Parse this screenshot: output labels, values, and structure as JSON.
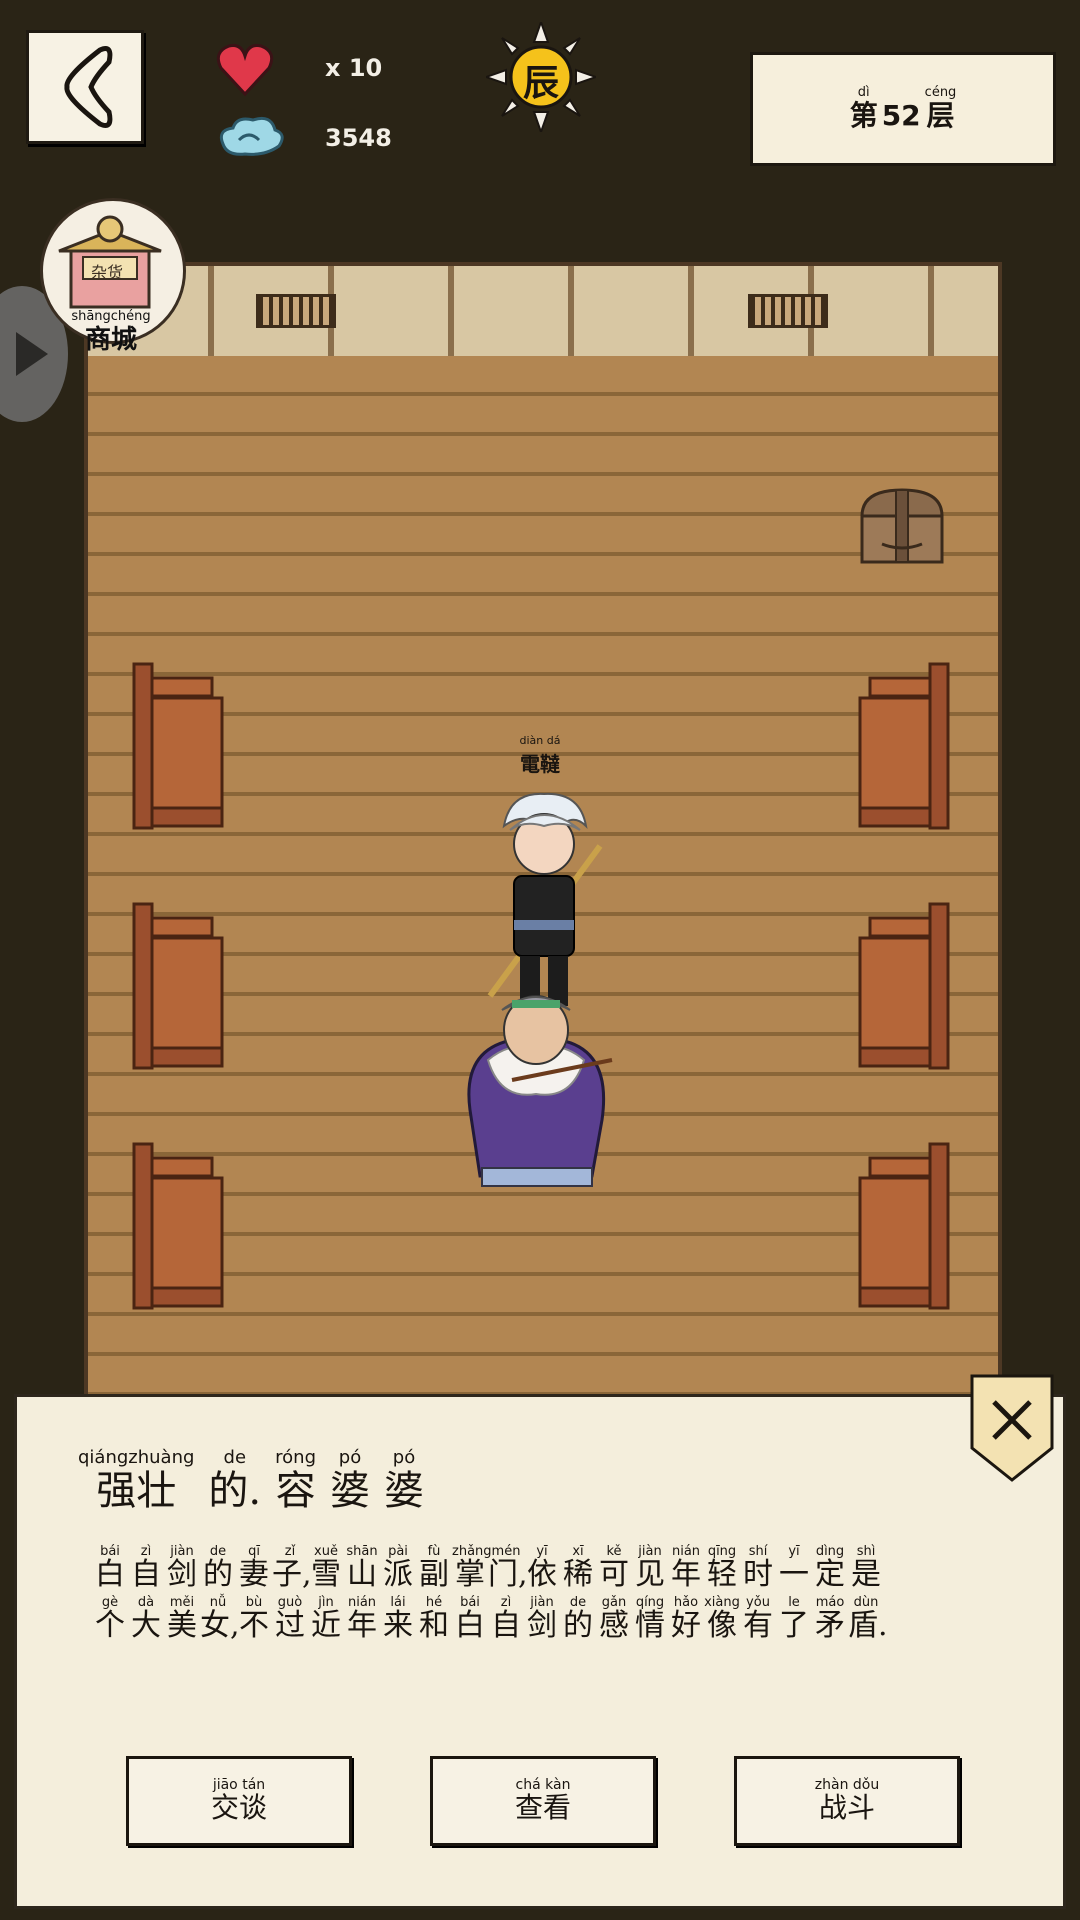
{
  "colors": {
    "background": "#2a2416",
    "panel": "#f4eedc",
    "floor": "#b28652",
    "heart": "#e0384a"
  },
  "topbar": {
    "lives": "x 10",
    "spirit": "3548",
    "time_badge": "辰",
    "floor": {
      "label": [
        {
          "py": "dì",
          "hz": "第"
        },
        {
          "py": "",
          "hz": "52"
        },
        {
          "py": "céng",
          "hz": "层"
        }
      ]
    }
  },
  "shop": {
    "sign": "杂货",
    "pinyin": "shāngchéng",
    "label": "商城"
  },
  "hero": {
    "name_pinyin": "diàn dá",
    "name": "電韃"
  },
  "dialog": {
    "title": [
      {
        "py": "qiángzhuàng",
        "hz": "强壮"
      },
      {
        "py": "de",
        "hz": "的."
      },
      {
        "py": "róng",
        "hz": "容"
      },
      {
        "py": "pó",
        "hz": "婆"
      },
      {
        "py": "pó",
        "hz": "婆"
      }
    ],
    "desc_line1": [
      {
        "py": "bái",
        "hz": "白"
      },
      {
        "py": "zì",
        "hz": "自"
      },
      {
        "py": "jiàn",
        "hz": "剑"
      },
      {
        "py": "de",
        "hz": "的"
      },
      {
        "py": "qī",
        "hz": "妻"
      },
      {
        "py": "zǐ",
        "hz": "子,"
      },
      {
        "py": "xuě",
        "hz": "雪"
      },
      {
        "py": "shān",
        "hz": "山"
      },
      {
        "py": "pài",
        "hz": "派"
      },
      {
        "py": "fù",
        "hz": "副"
      },
      {
        "py": "zhǎng",
        "hz": "掌"
      },
      {
        "py": "mén",
        "hz": "门,"
      },
      {
        "py": "yī",
        "hz": "依"
      },
      {
        "py": "xī",
        "hz": "稀"
      },
      {
        "py": "kě",
        "hz": "可"
      },
      {
        "py": "jiàn",
        "hz": "见"
      },
      {
        "py": "nián",
        "hz": "年"
      },
      {
        "py": "qīng",
        "hz": "轻"
      },
      {
        "py": "shí",
        "hz": "时"
      },
      {
        "py": "yī",
        "hz": "一"
      },
      {
        "py": "dìng",
        "hz": "定"
      },
      {
        "py": "shì",
        "hz": "是"
      }
    ],
    "desc_line2": [
      {
        "py": "gè",
        "hz": "个"
      },
      {
        "py": "dà",
        "hz": "大"
      },
      {
        "py": "měi",
        "hz": "美"
      },
      {
        "py": "nǚ",
        "hz": "女,"
      },
      {
        "py": "bù",
        "hz": "不"
      },
      {
        "py": "guò",
        "hz": "过"
      },
      {
        "py": "jìn",
        "hz": "近"
      },
      {
        "py": "nián",
        "hz": "年"
      },
      {
        "py": "lái",
        "hz": "来"
      },
      {
        "py": "hé",
        "hz": "和"
      },
      {
        "py": "bái",
        "hz": "白"
      },
      {
        "py": "zì",
        "hz": "自"
      },
      {
        "py": "jiàn",
        "hz": "剑"
      },
      {
        "py": "de",
        "hz": "的"
      },
      {
        "py": "gǎn",
        "hz": "感"
      },
      {
        "py": "qíng",
        "hz": "情"
      },
      {
        "py": "hǎo",
        "hz": "好"
      },
      {
        "py": "xiàng",
        "hz": "像"
      },
      {
        "py": "yǒu",
        "hz": "有"
      },
      {
        "py": "le",
        "hz": "了"
      },
      {
        "py": "máo",
        "hz": "矛"
      },
      {
        "py": "dùn",
        "hz": "盾."
      }
    ],
    "actions": [
      {
        "py": "jiāo tán",
        "hz": "交谈"
      },
      {
        "py": "chá kàn",
        "hz": "查看"
      },
      {
        "py": "zhàn dǒu",
        "hz": "战斗"
      }
    ]
  }
}
